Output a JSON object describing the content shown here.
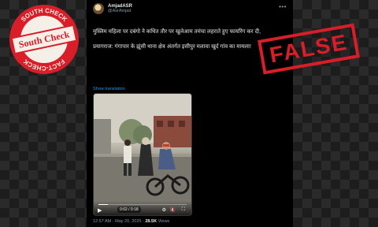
{
  "tweet": {
    "display_name": "AmjadASR",
    "handle": "@AsrAmjad",
    "text_line_1": "मुस्लिम महिला पर दबंगो ने कथित तौर पर खुलेआम तमंचा लहराते हुए फायरिंग कर दी,",
    "text_line_2": "प्रयागराज: गंगापार के झूंसी थाना क्षेत्र अंतर्गत इसीपुर मलावा खुर्द गांव का मामला!",
    "show_translation": "Show translation",
    "video_time": "0:02 / 0:18",
    "video_progress": 0.11,
    "posted_time": "12:57 AM · May 20, 2025",
    "views": "28.5K",
    "views_label": "Views"
  },
  "logo": {
    "top_text": "SOUTH CHECK",
    "bottom_text": "FACT-CHECK",
    "center_text": "South Check"
  },
  "verdict": {
    "label": "FALSE"
  },
  "colors": {
    "accent": "#d91d29",
    "link": "#1d9bf0"
  }
}
